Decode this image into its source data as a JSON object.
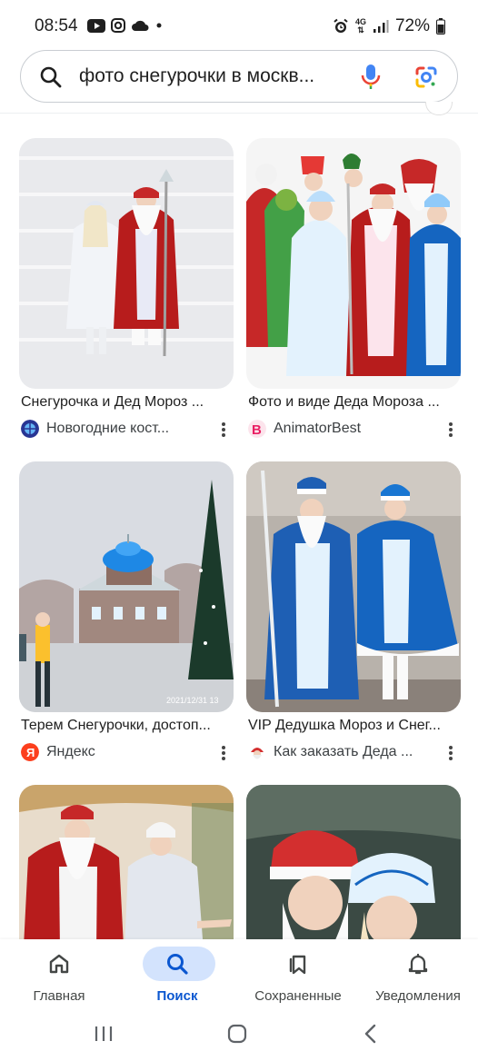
{
  "status_bar": {
    "time": "08:54",
    "network": "4G",
    "battery": "72%",
    "icons": [
      "youtube-icon",
      "instagram-icon",
      "cloud-icon",
      "dot-icon",
      "alarm-icon",
      "signal-icon",
      "battery-icon"
    ]
  },
  "search": {
    "query": "фото снегурочки в москв...",
    "icons": [
      "search-icon",
      "mic-icon",
      "google-lens-icon"
    ]
  },
  "results": [
    {
      "title": "Снегурочка и Дед Мороз ...",
      "source": "Новогодние кост...",
      "favicon": "globe-favicon",
      "favicon_color": "#3949ab"
    },
    {
      "title": "Фото и виде Деда Мороза ...",
      "source": "AnimatorBest",
      "favicon": "animatorbest-favicon",
      "favicon_color": "#e91e63"
    },
    {
      "title": "Терем Снегурочки, достоп...",
      "source": "Яндекс",
      "favicon": "yandex-favicon",
      "favicon_color": "#fc3f1d"
    },
    {
      "title": "VIP Дедушка Мороз и Снег...",
      "source": "Как заказать Деда ...",
      "favicon": "santa-favicon",
      "favicon_color": "#d32f2f"
    },
    {
      "title": "",
      "source": ""
    },
    {
      "title": "",
      "source": ""
    }
  ],
  "bottom_nav": {
    "items": [
      {
        "label": "Главная",
        "icon": "home-icon",
        "active": false
      },
      {
        "label": "Поиск",
        "icon": "search-icon",
        "active": true
      },
      {
        "label": "Сохраненные",
        "icon": "bookmarks-icon",
        "active": false
      },
      {
        "label": "Уведомления",
        "icon": "bell-icon",
        "active": false
      }
    ]
  },
  "system_nav": [
    "recents-button",
    "home-button",
    "back-button"
  ],
  "colors": {
    "accent": "#0b57d0",
    "active_pill": "#d3e3fd"
  }
}
